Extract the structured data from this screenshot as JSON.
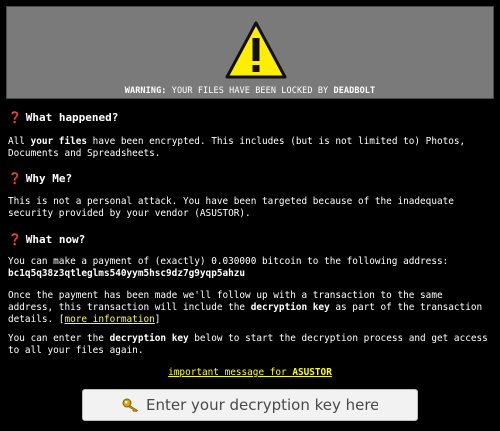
{
  "banner": {
    "warning_label": "WARNING:",
    "message": "YOUR FILES HAVE BEEN LOCKED BY",
    "brand": "DEADBOLT"
  },
  "section1": {
    "icon": "question-mark-icon",
    "title": "What happened?",
    "pre": "All ",
    "bold": "your files",
    "post": " have been encrypted. This includes (but is not limited to) Photos, Documents and Spreadsheets."
  },
  "section2": {
    "icon": "question-mark-icon",
    "title": "Why Me?",
    "text": "This is not a personal attack. You have been targeted because of the inadequate security provided by your vendor (ASUSTOR)."
  },
  "section3": {
    "icon": "question-mark-icon",
    "title": "What now?",
    "payment_text": "You can make a payment of (exactly) 0.030000 bitcoin to the following address:",
    "address": "bc1q5q38z3qtleglms540yym5hsc9dz7g9yqp5ahzu",
    "followup_pre": "Once the payment has been made we'll follow up with a transaction to the same address, this transaction will include the ",
    "followup_bold": "decryption key",
    "followup_post": " as part of the transaction details. [",
    "more_info_link": "more information",
    "followup_end": "]",
    "enter_pre": "You can enter the ",
    "enter_bold": "decryption key",
    "enter_post": " below to start the decryption process and get access to all your files again."
  },
  "important": {
    "link_text": "important message for ",
    "link_bold": "ASUSTOR"
  },
  "key_input": {
    "placeholder": "Enter your decryption key here..",
    "icon": "key-icon"
  },
  "colors": {
    "background": "#000000",
    "banner": "#7a7a7a",
    "warning_yellow": "#ffee00",
    "question_red": "#d3232b",
    "link_yellow": "#ffff00"
  }
}
